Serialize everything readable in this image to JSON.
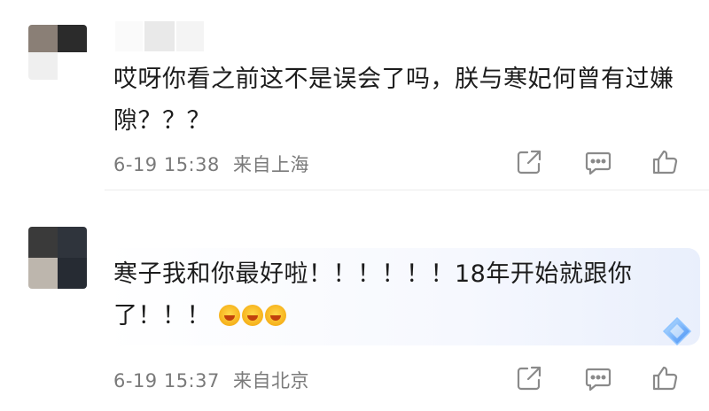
{
  "comments": [
    {
      "text": "哎呀你看之前这不是误会了吗，朕与寒妃何曾有过嫌隙？？？",
      "time": "6-19 15:38",
      "location": "来自上海",
      "avatar_colors": [
        "#8a7f76",
        "#2b2b2b",
        "#efefef",
        "#ffffff"
      ]
    },
    {
      "text": "寒子我和你最好啦！！！！！！18年开始就跟你了！！！",
      "emoji_count": 3,
      "time": "6-19 15:37",
      "location": "来自北京",
      "avatar_colors": [
        "#3a3a3a",
        "#2f343c",
        "#bdb6ad",
        "#262b33"
      ]
    }
  ],
  "icons": [
    "share-icon",
    "comment-icon",
    "like-icon",
    "diamond-badge-icon",
    "laughing-emoji-icon"
  ]
}
